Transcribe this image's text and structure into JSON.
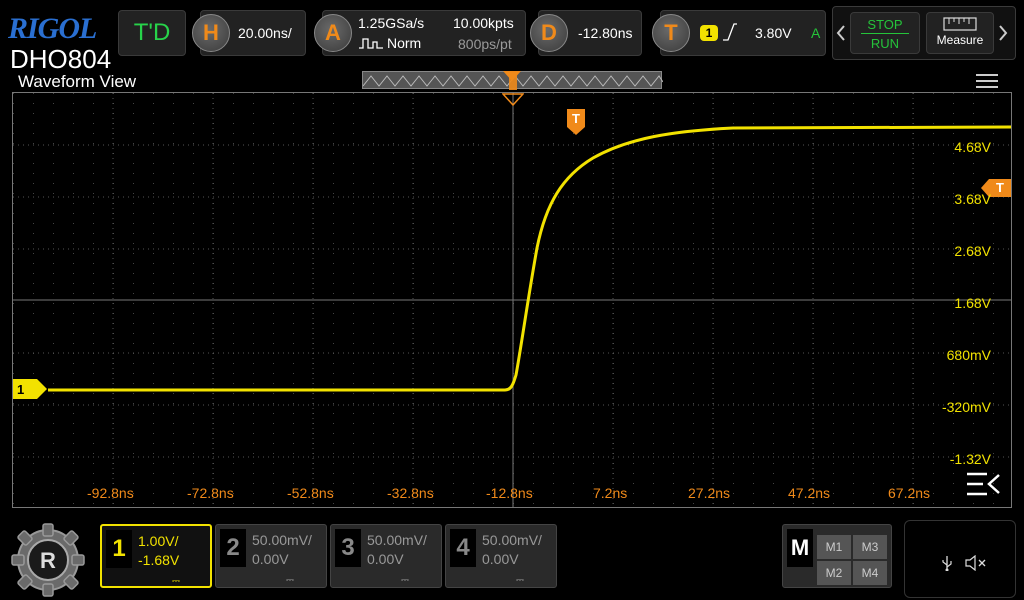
{
  "brand": {
    "name": "RIGOL",
    "model": "DHO804"
  },
  "topbar": {
    "mode_label": "T'D",
    "horizontal": {
      "key": "H",
      "scale": "20.00ns/"
    },
    "acquire": {
      "key": "A",
      "sample_rate": "1.25GSa/s",
      "mode": "Norm",
      "memory": "10.00kpts",
      "resolution": "800ps/pt"
    },
    "delay": {
      "key": "D",
      "value": "-12.80ns"
    },
    "trigger": {
      "key": "T",
      "source": "1",
      "level": "3.80V",
      "sweep": "A"
    },
    "run_control": {
      "stop_label": "STOP",
      "run_label": "RUN"
    },
    "measure_label": "Measure"
  },
  "waveform_view": {
    "title": "Waveform View",
    "trigger_marker": "T",
    "channel_marker": "1",
    "x_labels": [
      "-92.8ns",
      "-72.8ns",
      "-52.8ns",
      "-32.8ns",
      "-12.8ns",
      "7.2ns",
      "27.2ns",
      "47.2ns",
      "67.2ns"
    ],
    "y_labels": [
      "4.68V",
      "3.68V",
      "2.68V",
      "1.68V",
      "680mV",
      "-320mV",
      "-1.32V"
    ]
  },
  "channels": [
    {
      "num": "1",
      "scale": "1.00V/",
      "offset": "-1.68V",
      "active": true
    },
    {
      "num": "2",
      "scale": "50.00mV/",
      "offset": "0.00V",
      "active": false
    },
    {
      "num": "3",
      "scale": "50.00mV/",
      "offset": "0.00V",
      "active": false
    },
    {
      "num": "4",
      "scale": "50.00mV/",
      "offset": "0.00V",
      "active": false
    }
  ],
  "math": {
    "key": "M",
    "items": [
      "M1",
      "M3",
      "M2",
      "M4"
    ]
  },
  "colors": {
    "ch1": "#f2e200",
    "accent": "#f08a1a",
    "run": "#25c43a",
    "brand": "#2a6fd1"
  },
  "icons": [
    "usb-icon",
    "speaker-muted-icon",
    "hamburger-menu-icon",
    "collapse-menu-icon"
  ]
}
